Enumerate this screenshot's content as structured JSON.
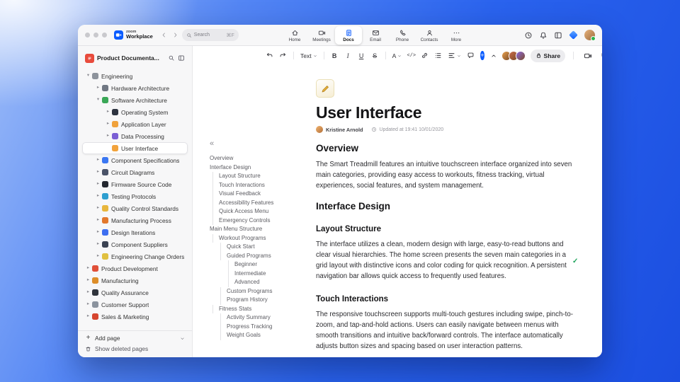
{
  "titlebar": {
    "brand_top": "zoom",
    "brand_bottom": "Workplace",
    "search_placeholder": "Search",
    "search_shortcut": "⌘F",
    "tabs": [
      {
        "label": "Home",
        "icon": "home",
        "active": false
      },
      {
        "label": "Meetings",
        "icon": "video",
        "active": false
      },
      {
        "label": "Docs",
        "icon": "doc",
        "active": true
      },
      {
        "label": "Email",
        "icon": "mail",
        "active": false
      },
      {
        "label": "Phone",
        "icon": "phone",
        "active": false
      },
      {
        "label": "Contacts",
        "icon": "contacts",
        "active": false
      },
      {
        "label": "More",
        "icon": "more",
        "active": false
      }
    ]
  },
  "sidebar": {
    "workspace_title": "Product Documenta...",
    "items": [
      {
        "label": "Engineering",
        "level": 0,
        "expanded": true,
        "color": "#8d939c"
      },
      {
        "label": "Hardware Architecture",
        "level": 1,
        "expanded": false,
        "color": "#707783"
      },
      {
        "label": "Software Architecture",
        "level": 1,
        "expanded": true,
        "color": "#3aa757"
      },
      {
        "label": "Operating System",
        "level": 2,
        "expanded": false,
        "color": "#2d3340"
      },
      {
        "label": "Application Layer",
        "level": 2,
        "expanded": false,
        "color": "#f0a23c"
      },
      {
        "label": "Data Processing",
        "level": 2,
        "expanded": false,
        "color": "#7b5fd4"
      },
      {
        "label": "User Interface",
        "level": 2,
        "expanded": false,
        "selected": true,
        "color": "#f2a33c"
      },
      {
        "label": "Component Specifications",
        "level": 1,
        "expanded": false,
        "color": "#3b77f2"
      },
      {
        "label": "Circuit Diagrams",
        "level": 1,
        "expanded": false,
        "color": "#4a5368"
      },
      {
        "label": "Firmware Source Code",
        "level": 1,
        "expanded": false,
        "color": "#23272f"
      },
      {
        "label": "Testing Protocols",
        "level": 1,
        "expanded": false,
        "color": "#2e9fd0"
      },
      {
        "label": "Quality Control Standards",
        "level": 1,
        "expanded": false,
        "color": "#e8b63c"
      },
      {
        "label": "Manufacturing Process",
        "level": 1,
        "expanded": false,
        "color": "#e2782c"
      },
      {
        "label": "Design Iterations",
        "level": 1,
        "expanded": false,
        "color": "#3d6ef0"
      },
      {
        "label": "Component Suppliers",
        "level": 1,
        "expanded": false,
        "color": "#3a4252"
      },
      {
        "label": "Engineering Change Orders",
        "level": 1,
        "expanded": false,
        "color": "#e0c040"
      },
      {
        "label": "Product Development",
        "level": 0,
        "expanded": false,
        "color": "#e05039"
      },
      {
        "label": "Manufacturing",
        "level": 0,
        "expanded": false,
        "color": "#dd8e2a"
      },
      {
        "label": "Quality Assurance",
        "level": 0,
        "expanded": false,
        "color": "#30343c"
      },
      {
        "label": "Customer Support",
        "level": 0,
        "expanded": false,
        "color": "#8b939e"
      },
      {
        "label": "Sales & Marketing",
        "level": 0,
        "expanded": false,
        "color": "#d6452f"
      }
    ],
    "add_page_label": "Add page",
    "show_deleted_label": "Show deleted pages"
  },
  "outline": {
    "collapse_glyph": "«",
    "items": [
      {
        "label": "Overview",
        "level": 0
      },
      {
        "label": "Interface Design",
        "level": 0
      },
      {
        "label": "Layout Structure",
        "level": 1
      },
      {
        "label": "Touch Interactions",
        "level": 1
      },
      {
        "label": "Visual Feedback",
        "level": 1
      },
      {
        "label": "Accessibility Features",
        "level": 1
      },
      {
        "label": "Quick Access Menu",
        "level": 1
      },
      {
        "label": "Emergency Controls",
        "level": 1
      },
      {
        "label": "Main Menu Structure",
        "level": 0
      },
      {
        "label": "Workout Programs",
        "level": 1
      },
      {
        "label": "Quick Start",
        "level": 2
      },
      {
        "label": "Guided Programs",
        "level": 2
      },
      {
        "label": "Beginner",
        "level": 3
      },
      {
        "label": "Intermediate",
        "level": 3
      },
      {
        "label": "Advanced",
        "level": 3
      },
      {
        "label": "Custom Programs",
        "level": 2
      },
      {
        "label": "Program History",
        "level": 2
      },
      {
        "label": "Fitness Stats",
        "level": 1
      },
      {
        "label": "Activity Summary",
        "level": 2
      },
      {
        "label": "Progress Tracking",
        "level": 2
      },
      {
        "label": "Weight Goals",
        "level": 2
      }
    ]
  },
  "toolbar": {
    "text_style_label": "Text",
    "buttons": {
      "bold": "B",
      "italic": "I",
      "underline": "U",
      "strikethrough": "S",
      "color": "A",
      "code": "</>"
    },
    "plus_glyph": "+",
    "share_label": "Share",
    "avatars": [
      "#e8a04c",
      "#c96b4a",
      "#8d6ae0"
    ]
  },
  "doc": {
    "title": "User Interface",
    "author": "Kristine Arnold",
    "updated": "Updated at 19:41 10/01/2020",
    "check_glyph": "✓",
    "sections": [
      {
        "type": "h2",
        "text": "Overview"
      },
      {
        "type": "p",
        "text": "The Smart Treadmill features an intuitive touchscreen interface organized into seven main categories, providing easy access to workouts, fitness tracking, virtual experiences, social features, and system management."
      },
      {
        "type": "h2",
        "text": "Interface Design"
      },
      {
        "type": "h3",
        "text": "Layout Structure"
      },
      {
        "type": "p",
        "text": "The interface utilizes a clean, modern design with large, easy-to-read buttons and clear visual hierarchies. The home screen presents the seven main categories in a grid layout with distinctive icons and color coding for quick recognition. A persistent navigation bar allows quick access to frequently used features."
      },
      {
        "type": "h3",
        "text": "Touch Interactions"
      },
      {
        "type": "p",
        "text": "The responsive touchscreen supports multi-touch gestures including swipe, pinch-to-zoom, and tap-and-hold actions. Users can easily navigate between menus with smooth transitions and intuitive back/forward controls. The interface automatically adjusts button sizes and spacing based on user interaction patterns."
      }
    ]
  },
  "colors": {
    "accent_blue": "#0b5cff",
    "check_green": "#1fa45c"
  }
}
